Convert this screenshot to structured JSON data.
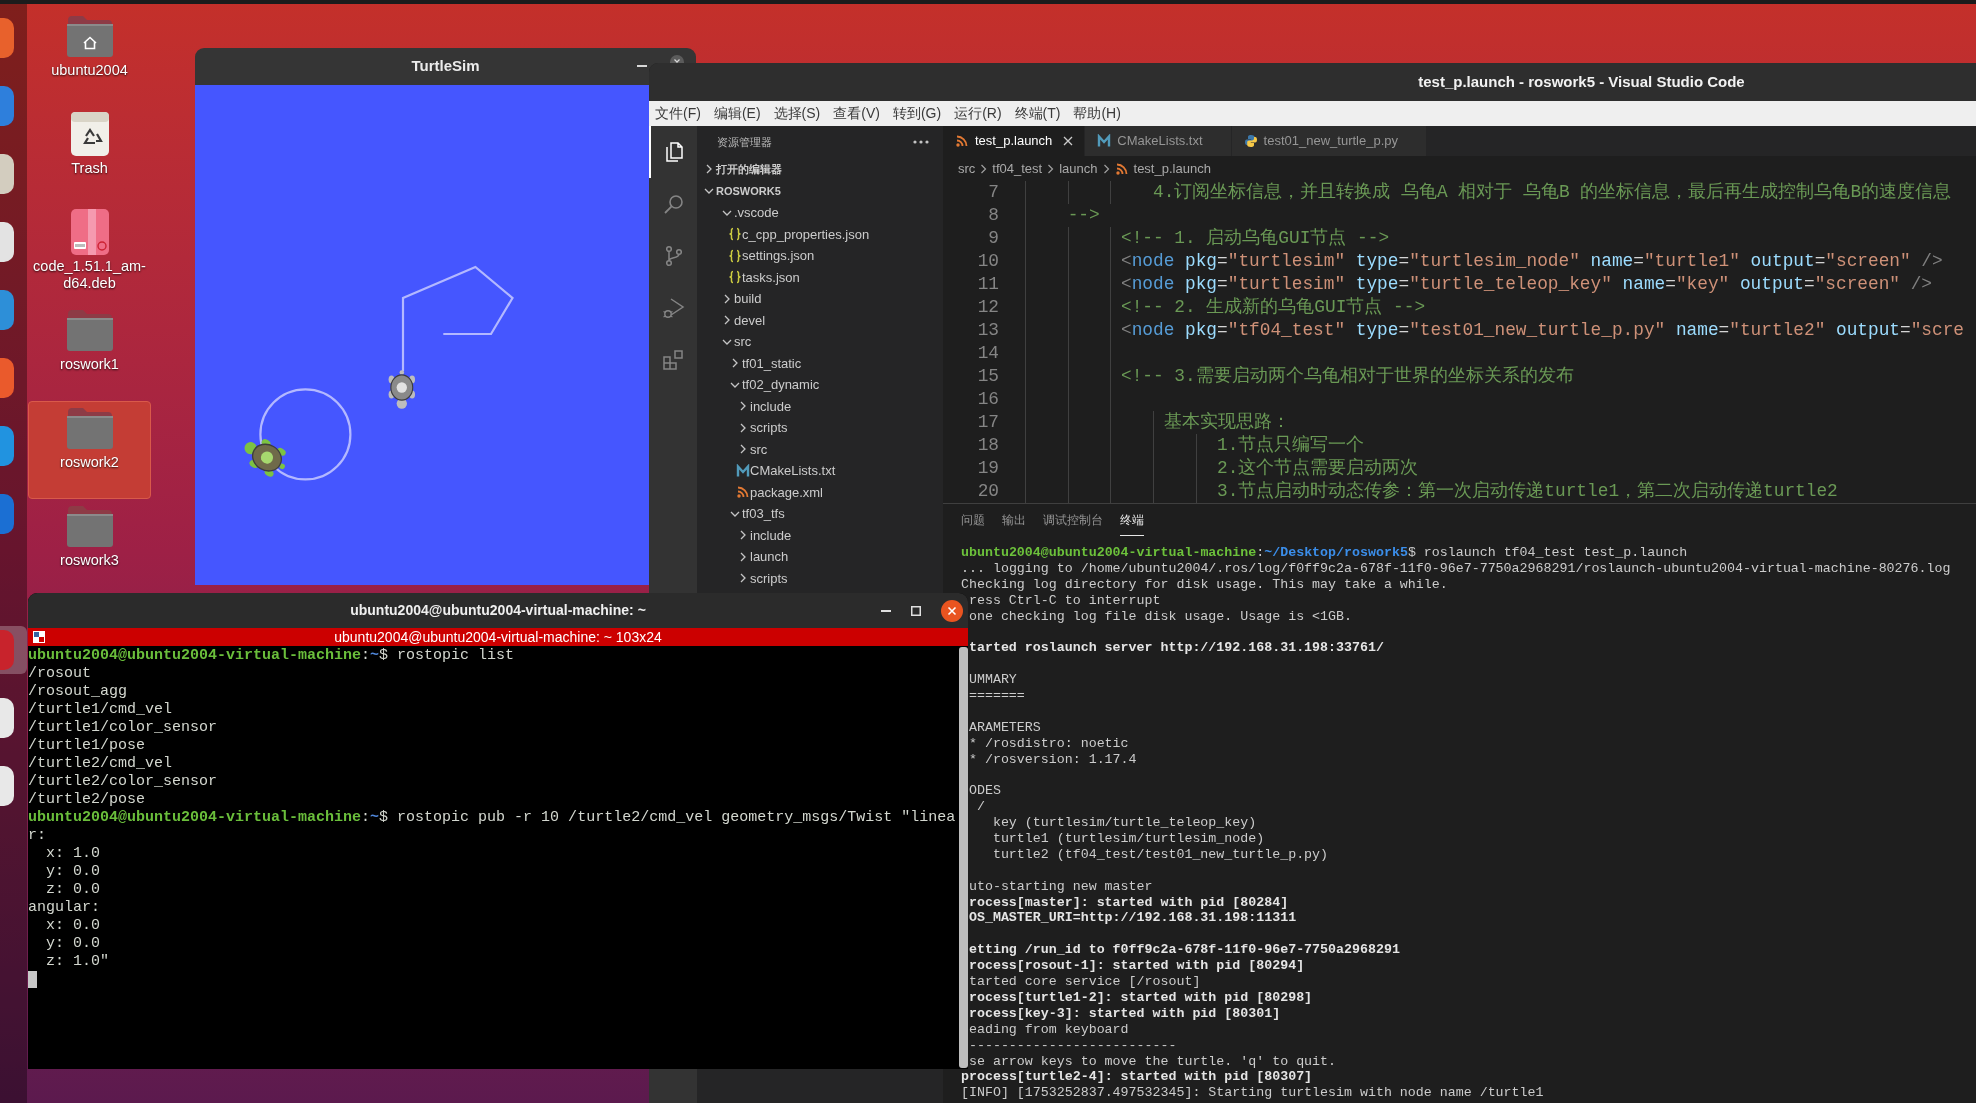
{
  "desktop": {
    "dock": [
      {
        "color": "#e8612c",
        "active": false
      },
      {
        "color": "#2e7fdc",
        "active": false
      },
      {
        "color": "#d3cdbf",
        "active": false
      },
      {
        "color": "#e3e3e3",
        "active": false
      },
      {
        "color": "#2d8fd8",
        "active": false
      },
      {
        "color": "#ea5a2c",
        "active": false
      },
      {
        "color": "#2193e0",
        "active": false
      },
      {
        "color": "#1b6fd3",
        "active": false
      },
      {
        "color": "#c8232c",
        "active": true
      },
      {
        "color": "#e8e8e8",
        "active": false
      },
      {
        "color": "#e8e8e8",
        "active": false
      }
    ],
    "icons": [
      {
        "label": "ubuntu2004",
        "kind": "home",
        "selected": false
      },
      {
        "label": "Trash",
        "kind": "trash",
        "selected": false
      },
      {
        "label": "code_1.51.1_am-d64.deb",
        "kind": "package",
        "selected": false
      },
      {
        "label": "roswork1",
        "kind": "folder",
        "selected": false
      },
      {
        "label": "roswork2",
        "kind": "folder",
        "selected": true
      },
      {
        "label": "roswork3",
        "kind": "folder",
        "selected": false
      }
    ]
  },
  "turtlesim": {
    "title": "TurtleSim"
  },
  "vscode": {
    "title": "test_p.launch - roswork5 - Visual Studio Code",
    "menu": [
      "文件(F)",
      "编辑(E)",
      "选择(S)",
      "查看(V)",
      "转到(G)",
      "运行(R)",
      "终端(T)",
      "帮助(H)"
    ],
    "activity": [
      {
        "kind": "files",
        "selected": true
      },
      {
        "kind": "search",
        "selected": false
      },
      {
        "kind": "branch",
        "selected": false
      },
      {
        "kind": "debug",
        "selected": false
      },
      {
        "kind": "extensions",
        "selected": false
      }
    ],
    "explorer": {
      "title": "资源管理器",
      "sections": [
        {
          "label": "打开的编辑器",
          "expanded": false
        },
        {
          "label": "ROSWORK5",
          "expanded": true,
          "children": [
            {
              "label": ".vscode",
              "kind": "folder",
              "expanded": true,
              "children": [
                {
                  "label": "c_cpp_properties.json",
                  "kind": "json"
                },
                {
                  "label": "settings.json",
                  "kind": "json"
                },
                {
                  "label": "tasks.json",
                  "kind": "json"
                }
              ]
            },
            {
              "label": "build",
              "kind": "folder",
              "expanded": false
            },
            {
              "label": "devel",
              "kind": "folder",
              "expanded": false
            },
            {
              "label": "src",
              "kind": "folder",
              "expanded": true,
              "children": [
                {
                  "label": "tf01_static",
                  "kind": "folder",
                  "expanded": false
                },
                {
                  "label": "tf02_dynamic",
                  "kind": "folder",
                  "expanded": true,
                  "children": [
                    {
                      "label": "include",
                      "kind": "folder",
                      "expanded": false
                    },
                    {
                      "label": "scripts",
                      "kind": "folder",
                      "expanded": false
                    },
                    {
                      "label": "src",
                      "kind": "folder",
                      "expanded": false
                    },
                    {
                      "label": "CMakeLists.txt",
                      "kind": "cmake"
                    },
                    {
                      "label": "package.xml",
                      "kind": "xml"
                    }
                  ]
                },
                {
                  "label": "tf03_tfs",
                  "kind": "folder",
                  "expanded": true,
                  "children": [
                    {
                      "label": "include",
                      "kind": "folder",
                      "expanded": false
                    },
                    {
                      "label": "launch",
                      "kind": "folder",
                      "expanded": false
                    },
                    {
                      "label": "scripts",
                      "kind": "folder",
                      "expanded": false
                    }
                  ]
                }
              ]
            }
          ]
        }
      ]
    },
    "tabs": [
      {
        "label": "test_p.launch",
        "kind": "xml",
        "selected": true
      },
      {
        "label": "CMakeLists.txt",
        "kind": "cmake",
        "selected": false
      },
      {
        "label": "test01_new_turtle_p.py",
        "kind": "python",
        "selected": false
      }
    ],
    "breadcrumb": [
      {
        "label": "src",
        "kind": "folder"
      },
      {
        "label": "tf04_test",
        "kind": "folder"
      },
      {
        "label": "launch",
        "kind": "folder"
      },
      {
        "label": "test_p.launch",
        "kind": "xml"
      }
    ],
    "editor": {
      "lines": [
        {
          "number": "7",
          "tokens": [
            {
              "kind": "comment",
              "text": "            4.订阅坐标信息，并且转换成 乌龟A 相对于 乌龟B 的坐标信息，最后再生成控制乌龟B的速度信息"
            }
          ]
        },
        {
          "number": "8",
          "tokens": [
            {
              "kind": "comment",
              "text": "    -->"
            }
          ]
        },
        {
          "number": "9",
          "tokens": [
            {
              "kind": "comment",
              "text": "         <!-- 1. 启动乌龟GUI节点 -->"
            }
          ]
        },
        {
          "number": "10",
          "tokens": [
            {
              "kind": "punct",
              "text": "         <"
            },
            {
              "kind": "tag",
              "text": "node"
            },
            {
              "kind": "attr",
              "text": " pkg"
            },
            {
              "kind": "plain",
              "text": "="
            },
            {
              "kind": "string",
              "text": "\"turtlesim\""
            },
            {
              "kind": "attr",
              "text": " type"
            },
            {
              "kind": "plain",
              "text": "="
            },
            {
              "kind": "string",
              "text": "\"turtlesim_node\""
            },
            {
              "kind": "attr",
              "text": " name"
            },
            {
              "kind": "plain",
              "text": "="
            },
            {
              "kind": "string",
              "text": "\"turtle1\""
            },
            {
              "kind": "attr",
              "text": " output"
            },
            {
              "kind": "plain",
              "text": "="
            },
            {
              "kind": "string",
              "text": "\"screen\""
            },
            {
              "kind": "punct",
              "text": " />"
            }
          ]
        },
        {
          "number": "11",
          "tokens": [
            {
              "kind": "punct",
              "text": "         <"
            },
            {
              "kind": "tag",
              "text": "node"
            },
            {
              "kind": "attr",
              "text": " pkg"
            },
            {
              "kind": "plain",
              "text": "="
            },
            {
              "kind": "string",
              "text": "\"turtlesim\""
            },
            {
              "kind": "attr",
              "text": " type"
            },
            {
              "kind": "plain",
              "text": "="
            },
            {
              "kind": "string",
              "text": "\"turtle_teleop_key\""
            },
            {
              "kind": "attr",
              "text": " name"
            },
            {
              "kind": "plain",
              "text": "="
            },
            {
              "kind": "string",
              "text": "\"key\""
            },
            {
              "kind": "attr",
              "text": " output"
            },
            {
              "kind": "plain",
              "text": "="
            },
            {
              "kind": "string",
              "text": "\"screen\""
            },
            {
              "kind": "punct",
              "text": " />"
            }
          ]
        },
        {
          "number": "12",
          "tokens": [
            {
              "kind": "comment",
              "text": "         <!-- 2. 生成新的乌龟GUI节点 -->"
            }
          ]
        },
        {
          "number": "13",
          "tokens": [
            {
              "kind": "punct",
              "text": "         <"
            },
            {
              "kind": "tag",
              "text": "node"
            },
            {
              "kind": "attr",
              "text": " pkg"
            },
            {
              "kind": "plain",
              "text": "="
            },
            {
              "kind": "string",
              "text": "\"tf04_test\""
            },
            {
              "kind": "attr",
              "text": " type"
            },
            {
              "kind": "plain",
              "text": "="
            },
            {
              "kind": "string",
              "text": "\"test01_new_turtle_p.py\""
            },
            {
              "kind": "attr",
              "text": " name"
            },
            {
              "kind": "plain",
              "text": "="
            },
            {
              "kind": "string",
              "text": "\"turtle2\""
            },
            {
              "kind": "attr",
              "text": " output"
            },
            {
              "kind": "plain",
              "text": "="
            },
            {
              "kind": "string",
              "text": "\"scre"
            }
          ]
        },
        {
          "number": "14"
        },
        {
          "number": "15",
          "tokens": [
            {
              "kind": "comment",
              "text": "         <!-- 3.需要启动两个乌龟相对于世界的坐标关系的发布"
            }
          ]
        },
        {
          "number": "16"
        },
        {
          "number": "17",
          "tokens": [
            {
              "kind": "comment",
              "text": "             基本实现思路："
            }
          ]
        },
        {
          "number": "18",
          "tokens": [
            {
              "kind": "comment",
              "text": "                  1.节点只编写一个"
            }
          ]
        },
        {
          "number": "19",
          "tokens": [
            {
              "kind": "comment",
              "text": "                  2.这个节点需要启动两次"
            }
          ]
        },
        {
          "number": "20",
          "tokens": [
            {
              "kind": "comment",
              "text": "                  3.节点启动时动态传参：第一次启动传递turtle1，第二次启动传递turtle2"
            }
          ]
        }
      ]
    },
    "panel": {
      "tabs": [
        {
          "label": "问题",
          "selected": false
        },
        {
          "label": "输出",
          "selected": false
        },
        {
          "label": "调试控制台",
          "selected": false
        },
        {
          "label": "终端",
          "selected": true
        }
      ],
      "blocks": [
        [
          [
            {
              "kind": "user",
              "text": "ubuntu2004@ubuntu2004-virtual-machine"
            },
            {
              "kind": "plain",
              "text": ":"
            },
            {
              "kind": "path",
              "text": "~/Desktop/roswork5"
            },
            {
              "kind": "plain",
              "text": "$ roslaunch tf04_test test_p.launch"
            }
          ],
          [
            {
              "kind": "plain",
              "text": "... logging to /home/ubuntu2004/.ros/log/f0ff9c2a-678f-11f0-96e7-7750a2968291/roslaunch-ubuntu2004-virtual-machine-80276.log"
            }
          ],
          [
            {
              "kind": "plain",
              "text": "Checking log directory for disk usage. This may take a while."
            }
          ],
          [
            {
              "kind": "plain",
              "text": "ress Ctrl-C to interrupt"
            }
          ],
          [
            {
              "kind": "plain",
              "text": "one checking log file disk usage. Usage is <1GB."
            }
          ]
        ],
        [
          [
            {
              "kind": "bold",
              "text": "tarted roslaunch server http://192.168.31.198:33761/"
            }
          ]
        ],
        [
          [
            {
              "kind": "plain",
              "text": "UMMARY"
            }
          ],
          [
            {
              "kind": "plain",
              "text": "======="
            }
          ]
        ],
        [
          [
            {
              "kind": "plain",
              "text": "ARAMETERS"
            }
          ],
          [
            {
              "kind": "plain",
              "text": "* /rosdistro: noetic"
            }
          ],
          [
            {
              "kind": "plain",
              "text": "* /rosversion: 1.17.4"
            }
          ]
        ],
        [
          [
            {
              "kind": "plain",
              "text": "ODES"
            }
          ],
          [
            {
              "kind": "plain",
              "text": " /"
            }
          ],
          [
            {
              "kind": "plain",
              "text": "   key (turtlesim/turtle_teleop_key)"
            }
          ],
          [
            {
              "kind": "plain",
              "text": "   turtle1 (turtlesim/turtlesim_node)"
            }
          ],
          [
            {
              "kind": "plain",
              "text": "   turtle2 (tf04_test/test01_new_turtle_p.py)"
            }
          ]
        ],
        [
          [
            {
              "kind": "plain",
              "text": "uto-starting new master"
            }
          ],
          [
            {
              "kind": "bold",
              "text": "rocess[master]: started with pid [80284]"
            }
          ],
          [
            {
              "kind": "bold",
              "text": "OS_MASTER_URI=http://192.168.31.198:11311"
            }
          ]
        ],
        [
          [
            {
              "kind": "bold",
              "text": "etting /run_id to f0ff9c2a-678f-11f0-96e7-7750a2968291"
            }
          ],
          [
            {
              "kind": "bold",
              "text": "rocess[rosout-1]: started with pid [80294]"
            }
          ],
          [
            {
              "kind": "plain",
              "text": "tarted core service [/rosout]"
            }
          ],
          [
            {
              "kind": "bold",
              "text": "rocess[turtle1-2]: started with pid [80298]"
            }
          ],
          [
            {
              "kind": "bold",
              "text": "rocess[key-3]: started with pid [80301]"
            }
          ],
          [
            {
              "kind": "plain",
              "text": "eading from keyboard"
            }
          ],
          [
            {
              "kind": "plain",
              "text": "--------------------------"
            }
          ],
          [
            {
              "kind": "plain",
              "text": "se arrow keys to move the turtle. 'q' to quit."
            }
          ],
          [
            {
              "kind": "bold",
              "text": "process[turtle2-4]: started with pid [80307]"
            }
          ],
          [
            {
              "kind": "plain",
              "text": "[INFO] [1753252837.497532345]: Starting turtlesim with node name /turtle1"
            }
          ]
        ]
      ]
    }
  },
  "terminal": {
    "title": "ubuntu2004@ubuntu2004-virtual-machine: ~",
    "tab_title": "ubuntu2004@ubuntu2004-virtual-machine: ~ 103x24",
    "cursor": true,
    "lines": [
      [
        {
          "kind": "user",
          "text": "ubuntu2004@ubuntu2004-virtual-machine"
        },
        {
          "kind": "plain",
          "text": ":"
        },
        {
          "kind": "path",
          "text": "~"
        },
        {
          "kind": "plain",
          "text": "$ rostopic list"
        }
      ],
      [
        {
          "kind": "plain",
          "text": "/rosout"
        }
      ],
      [
        {
          "kind": "plain",
          "text": "/rosout_agg"
        }
      ],
      [
        {
          "kind": "plain",
          "text": "/turtle1/cmd_vel"
        }
      ],
      [
        {
          "kind": "plain",
          "text": "/turtle1/color_sensor"
        }
      ],
      [
        {
          "kind": "plain",
          "text": "/turtle1/pose"
        }
      ],
      [
        {
          "kind": "plain",
          "text": "/turtle2/cmd_vel"
        }
      ],
      [
        {
          "kind": "plain",
          "text": "/turtle2/color_sensor"
        }
      ],
      [
        {
          "kind": "plain",
          "text": "/turtle2/pose"
        }
      ],
      [
        {
          "kind": "user",
          "text": "ubuntu2004@ubuntu2004-virtual-machine"
        },
        {
          "kind": "plain",
          "text": ":"
        },
        {
          "kind": "path",
          "text": "~"
        },
        {
          "kind": "plain",
          "text": "$ rostopic pub -r 10 /turtle2/cmd_vel geometry_msgs/Twist \"linea"
        }
      ],
      [
        {
          "kind": "plain",
          "text": "r:"
        }
      ],
      [
        {
          "kind": "plain",
          "text": "  x: 1.0"
        }
      ],
      [
        {
          "kind": "plain",
          "text": "  y: 0.0"
        }
      ],
      [
        {
          "kind": "plain",
          "text": "  z: 0.0"
        }
      ],
      [
        {
          "kind": "plain",
          "text": "angular:"
        }
      ],
      [
        {
          "kind": "plain",
          "text": "  x: 0.0"
        }
      ],
      [
        {
          "kind": "plain",
          "text": "  y: 0.0"
        }
      ],
      [
        {
          "kind": "plain",
          "text": "  z: 1.0\""
        }
      ]
    ]
  }
}
